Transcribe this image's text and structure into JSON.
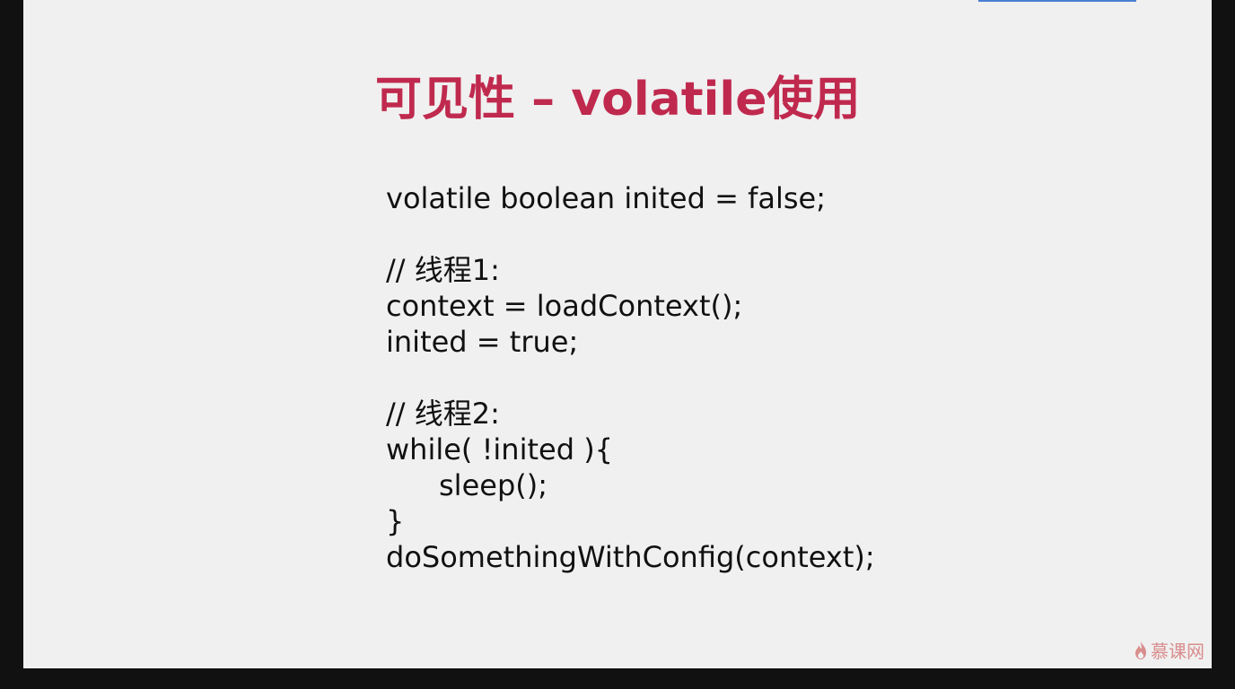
{
  "slide": {
    "title": "可见性 – volatile使用",
    "code_lines": [
      "volatile boolean inited = false;",
      "",
      "// 线程1:",
      "context = loadContext();",
      "inited = true;",
      "",
      "// 线程2:",
      "while( !inited ){",
      "sleep();",
      "}",
      "doSomethingWithConfig(context);"
    ]
  },
  "watermark": {
    "text": "慕课网",
    "icon": "flame-icon",
    "color": "#d98d8d"
  },
  "colors": {
    "title": "#c0294e",
    "slide_background": "#f0f0f0",
    "frame_background": "#111111",
    "top_accent": "#4a7fd4"
  }
}
